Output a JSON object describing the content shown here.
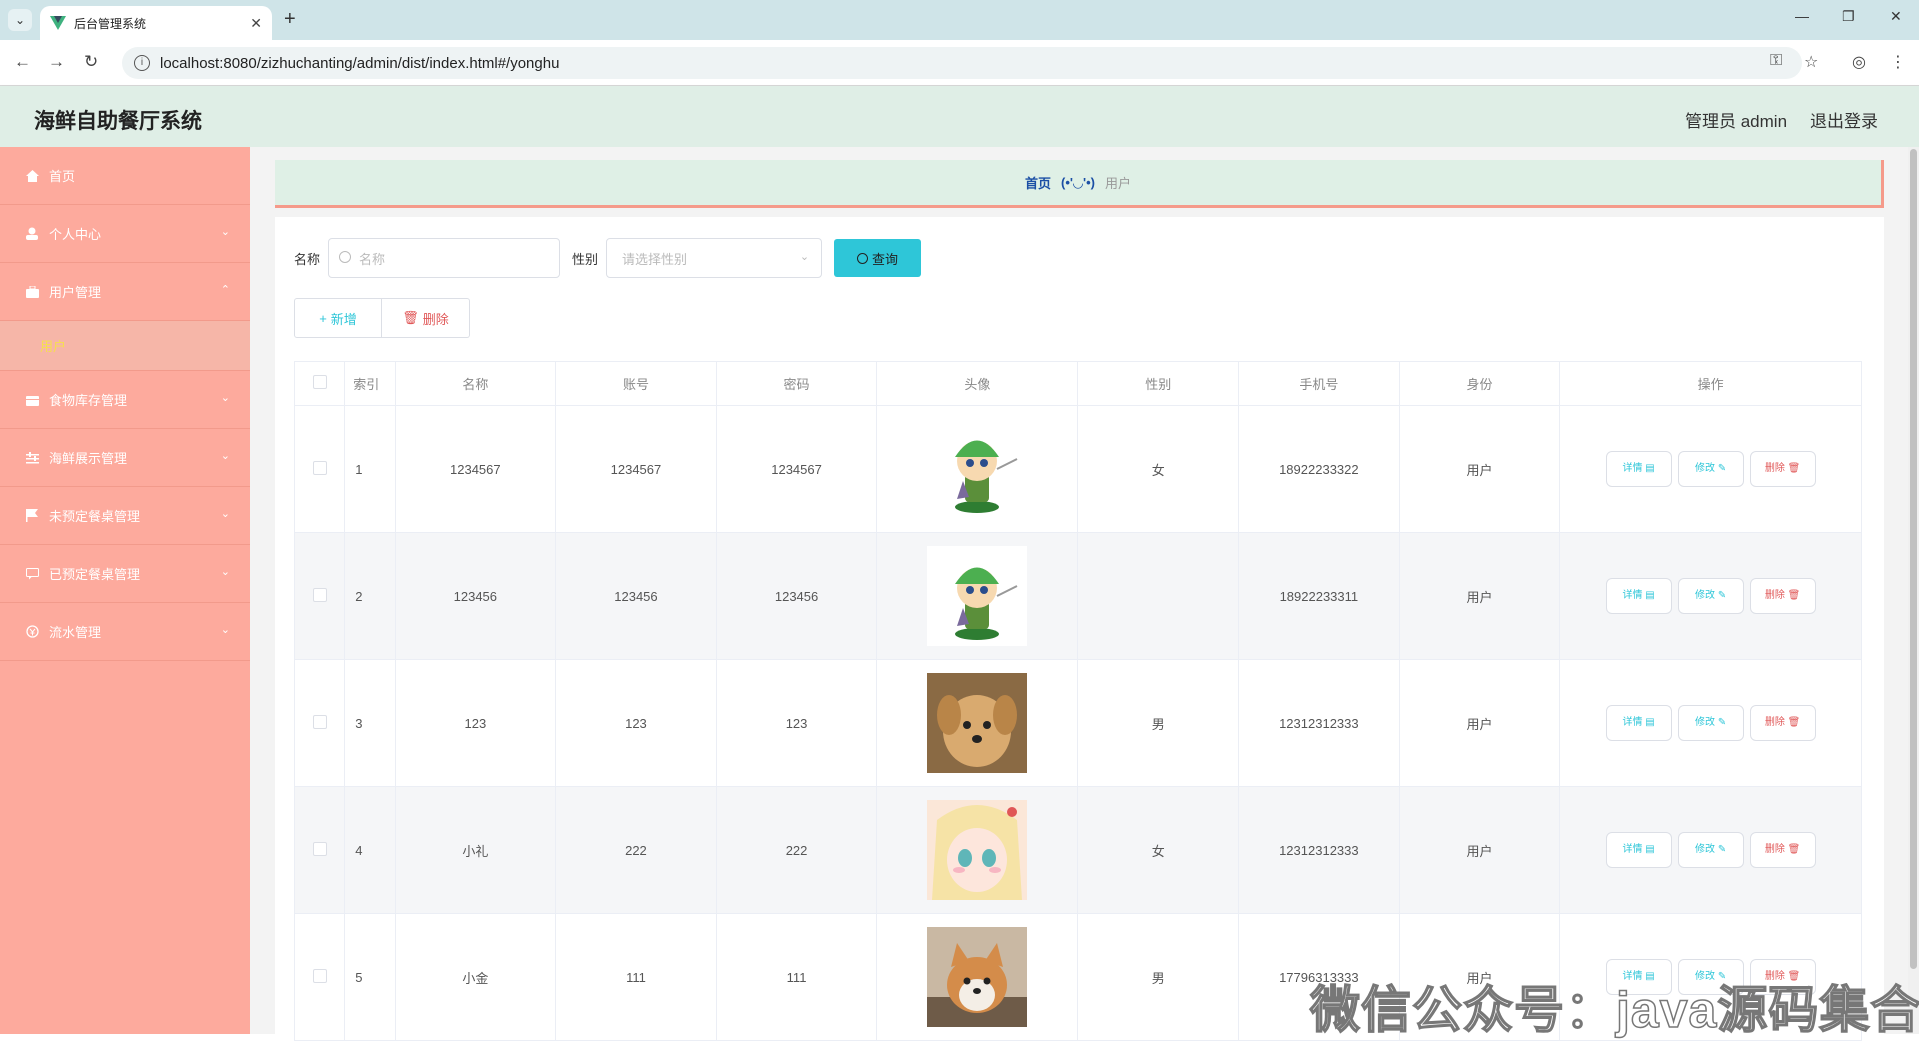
{
  "browser": {
    "tab_title": "后台管理系统",
    "url": "localhost:8080/zizhuchanting/admin/dist/index.html#/yonghu"
  },
  "header": {
    "title": "海鲜自助餐厅系统",
    "admin_label": "管理员 admin",
    "logout_label": "退出登录"
  },
  "sidebar": {
    "items": [
      {
        "label": "首页",
        "icon": "home-icon",
        "expandable": false
      },
      {
        "label": "个人中心",
        "icon": "user-icon",
        "expandable": true
      },
      {
        "label": "用户管理",
        "icon": "briefcase-icon",
        "expandable": true,
        "expanded": true
      },
      {
        "label": "食物库存管理",
        "icon": "box-icon",
        "expandable": true
      },
      {
        "label": "海鲜展示管理",
        "icon": "sliders-icon",
        "expandable": true
      },
      {
        "label": "未预定餐桌管理",
        "icon": "flag-icon",
        "expandable": true
      },
      {
        "label": "已预定餐桌管理",
        "icon": "chat-icon",
        "expandable": true
      },
      {
        "label": "流水管理",
        "icon": "money-icon",
        "expandable": true
      }
    ],
    "sub_item": "用户"
  },
  "breadcrumb": {
    "home": "首页",
    "face": "(•'◡'•)",
    "current": "用户"
  },
  "search": {
    "name_label": "名称",
    "name_placeholder": "名称",
    "gender_label": "性别",
    "gender_placeholder": "请选择性别",
    "query_button": "查询"
  },
  "actions": {
    "add": "新增",
    "delete": "删除"
  },
  "table": {
    "headers": [
      "索引",
      "名称",
      "账号",
      "密码",
      "头像",
      "性别",
      "手机号",
      "身份",
      "操作"
    ],
    "rows": [
      {
        "index": "1",
        "name": "1234567",
        "account": "1234567",
        "password": "1234567",
        "avatar": "cartoon-link",
        "gender": "女",
        "phone": "18922233322",
        "role": "用户"
      },
      {
        "index": "2",
        "name": "123456",
        "account": "123456",
        "password": "123456",
        "avatar": "cartoon-link",
        "gender": "",
        "phone": "18922233311",
        "role": "用户"
      },
      {
        "index": "3",
        "name": "123",
        "account": "123",
        "password": "123",
        "avatar": "puppy",
        "gender": "男",
        "phone": "12312312333",
        "role": "用户"
      },
      {
        "index": "4",
        "name": "小礼",
        "account": "222",
        "password": "222",
        "avatar": "anime-girl",
        "gender": "女",
        "phone": "12312312333",
        "role": "用户"
      },
      {
        "index": "5",
        "name": "小金",
        "account": "111",
        "password": "111",
        "avatar": "shiba",
        "gender": "男",
        "phone": "17796313333",
        "role": "用户"
      }
    ],
    "op_labels": {
      "detail": "详情",
      "edit": "修改",
      "delete": "删除"
    }
  },
  "watermark": "微信公众号：java源码集合",
  "colors": {
    "sidebar": "#fdaa9d",
    "header": "#dfeee6",
    "accent": "#2ec6d8",
    "danger": "#e05757",
    "submenu_active": "#f6e04d"
  }
}
